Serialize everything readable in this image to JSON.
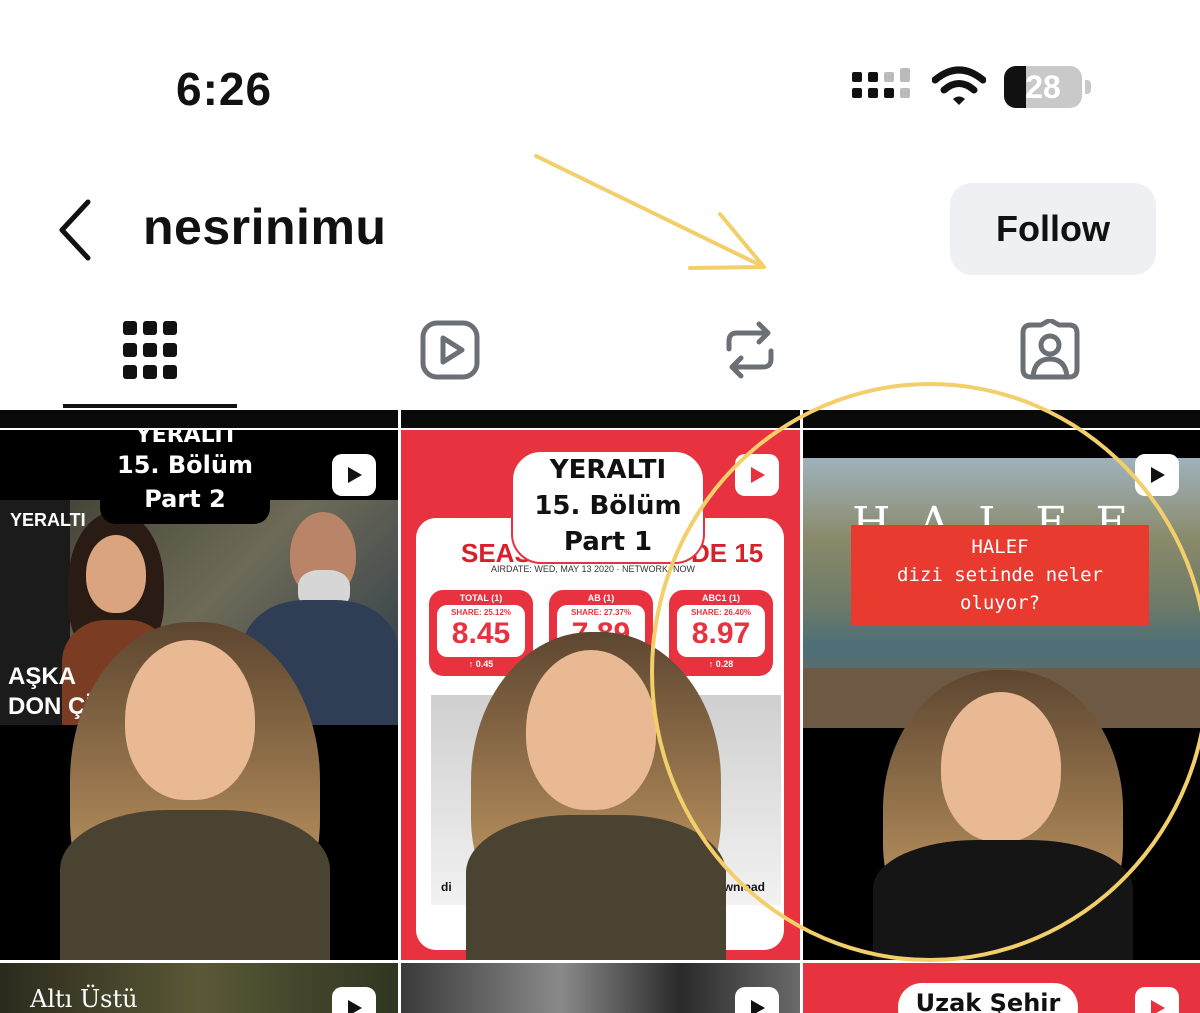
{
  "status_bar": {
    "time": "6:26",
    "battery_level": "28",
    "icons": [
      "cellular-signal-icon",
      "wifi-icon",
      "battery-icon"
    ]
  },
  "header": {
    "username": "nesrinimu",
    "follow_label": "Follow"
  },
  "tabs": [
    {
      "name": "posts-grid",
      "icon": "grid-icon",
      "active": true
    },
    {
      "name": "reels",
      "icon": "reels-play-icon",
      "active": false
    },
    {
      "name": "reposts",
      "icon": "repost-icon",
      "active": false
    },
    {
      "name": "tagged",
      "icon": "tagged-user-icon",
      "active": false
    }
  ],
  "posts": [
    {
      "overlay_title": "YERALTI",
      "overlay_line1": "15. Bölüm",
      "overlay_line2": "Part 2",
      "side_label": "YERALTI",
      "bottom_text_1": "AŞKA",
      "bottom_text_2": "DON ÇİÇ"
    },
    {
      "bubble_title": "YERALTI",
      "bubble_line1": "15. Bölüm",
      "bubble_line2": "Part 1",
      "heading_left": "SEAS",
      "heading_right": "DE 15",
      "airdate": "AIRDATE: WED, MAY 13 2020 · NETWORK: NOW",
      "stats": [
        {
          "label": "TOTAL (1)",
          "share": "SHARE: 25.12%",
          "value": "8.45",
          "delta": "0.45"
        },
        {
          "label": "AB (1)",
          "share": "SHARE: 27.37%",
          "value": "7.89",
          "delta": ""
        },
        {
          "label": "ABC1 (1)",
          "share": "SHARE: 26.40%",
          "value": "8.97",
          "delta": "0.28"
        }
      ],
      "footer_left": "di",
      "footer_right": "download"
    },
    {
      "logo_text": "HALEF",
      "caption_line1": "HALEF",
      "caption_line2": "dizi setinde neler",
      "caption_line3": "oluyor?"
    }
  ],
  "bottom_row": {
    "left_text": "Altı Üstü",
    "right_text": "Uzak Şehir"
  },
  "colors": {
    "annotation": "#f2cf6a",
    "accent_red": "#e8323f"
  }
}
